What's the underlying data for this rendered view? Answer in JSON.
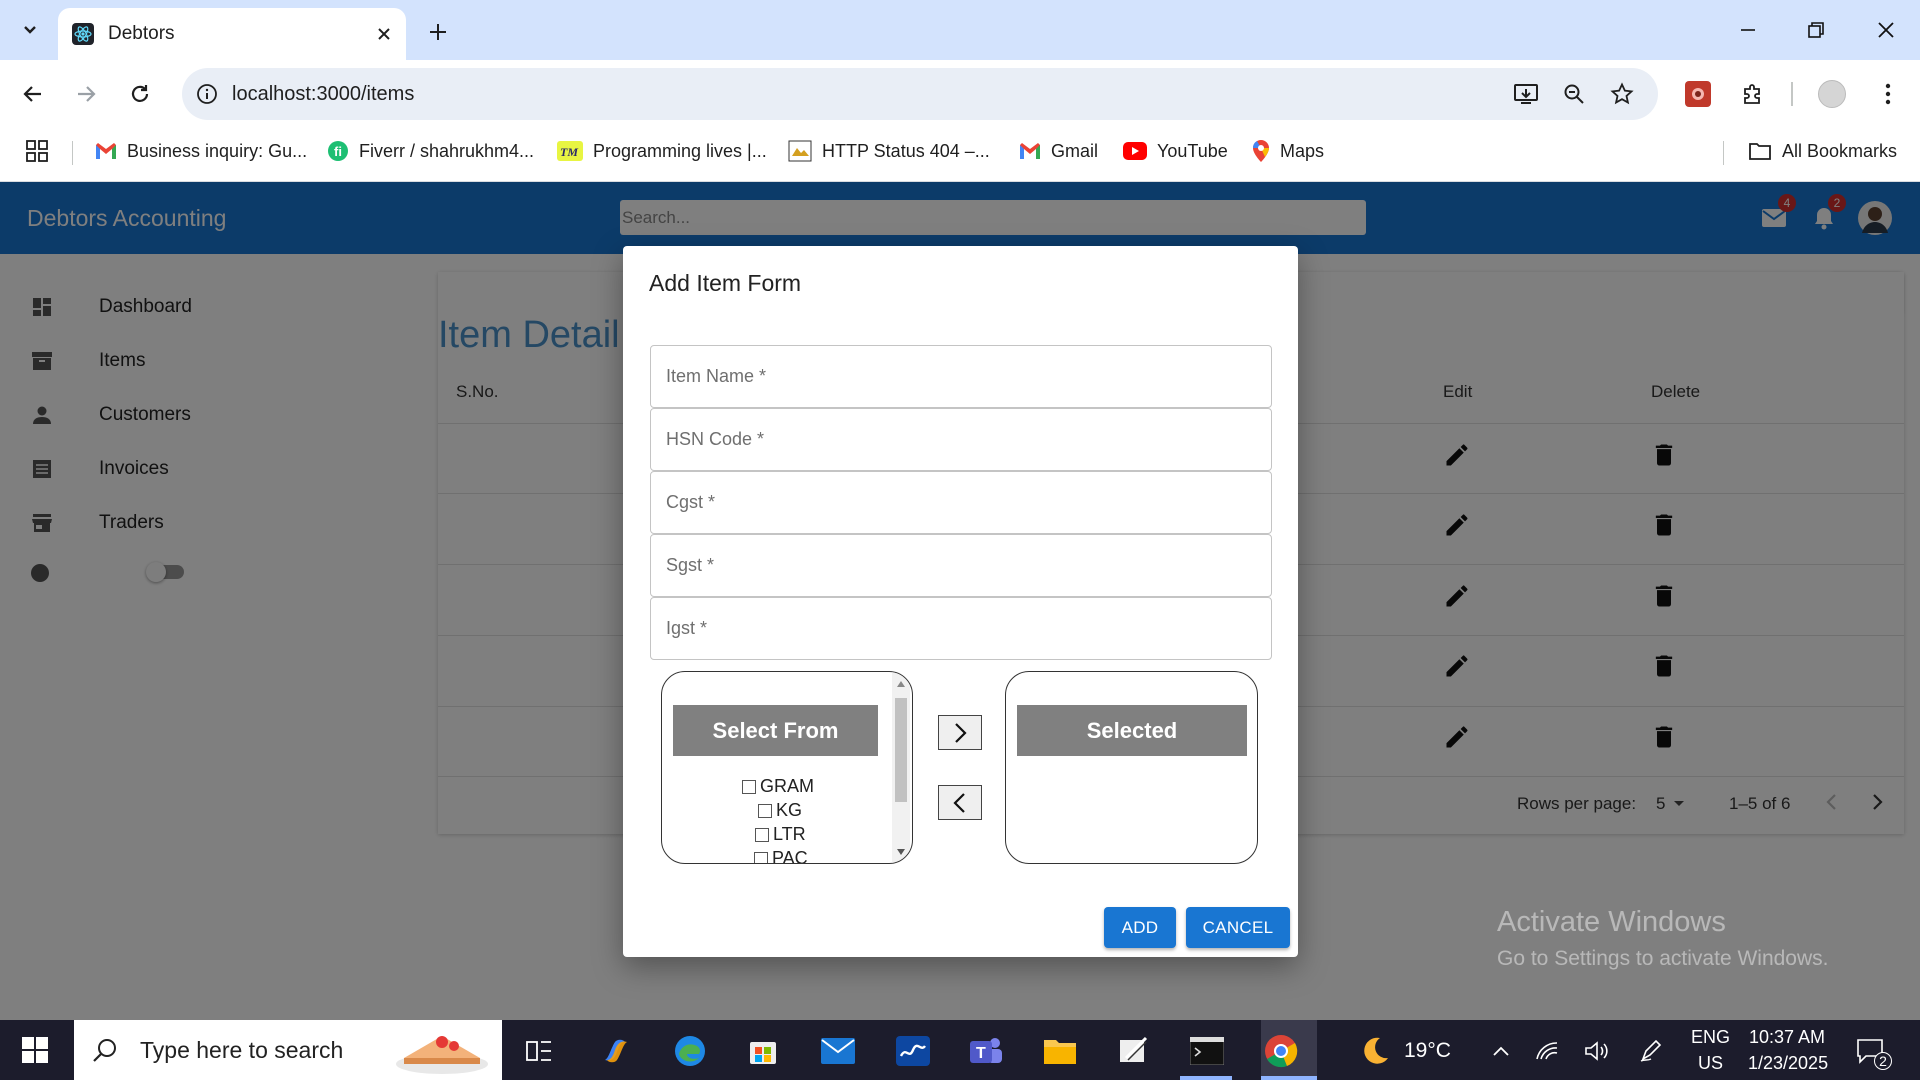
{
  "browser": {
    "tab_title": "Debtors",
    "url": "localhost:3000/items",
    "bookmarks": [
      {
        "label": "Business inquiry: Gu...",
        "icon": "gmail-icon"
      },
      {
        "label": "Fiverr / shahrukhm4...",
        "icon": "fiverr-icon"
      },
      {
        "label": "Programming lives |...",
        "icon": "tm-icon"
      },
      {
        "label": "HTTP Status 404 –...",
        "icon": "tomcat-icon"
      },
      {
        "label": "Gmail",
        "icon": "gmail-icon"
      },
      {
        "label": "YouTube",
        "icon": "youtube-icon"
      },
      {
        "label": "Maps",
        "icon": "maps-icon"
      }
    ],
    "all_bookmarks": "All Bookmarks"
  },
  "app": {
    "title": "Debtors Accounting",
    "search_placeholder": "Search...",
    "mail_count": "4",
    "notification_count": "2",
    "colors": {
      "primary": "#1976d2",
      "heading": "#4a90c8"
    }
  },
  "sidebar": {
    "items": [
      {
        "label": "Dashboard",
        "icon": "dashboard-icon"
      },
      {
        "label": "Items",
        "icon": "archive-icon"
      },
      {
        "label": "Customers",
        "icon": "person-icon"
      },
      {
        "label": "Invoices",
        "icon": "list-icon"
      },
      {
        "label": "Traders",
        "icon": "store-icon"
      }
    ]
  },
  "page": {
    "heading": "Item Detail",
    "columns": {
      "sno": "S.No.",
      "edit": "Edit",
      "delete": "Delete"
    },
    "pagination": {
      "rows_per_page_label": "Rows per page:",
      "rows_per_page": "5",
      "range": "1–5 of 6"
    }
  },
  "dialog": {
    "title": "Add Item Form",
    "fields": {
      "item_name": "Item Name *",
      "hsn_code": "HSN Code *",
      "cgst": "Cgst *",
      "sgst": "Sgst *",
      "igst": "Igst *"
    },
    "select_from_label": "Select From",
    "selected_label": "Selected",
    "units": [
      "GRAM",
      "KG",
      "LTR",
      "PAC"
    ],
    "add_button": "ADD",
    "cancel_button": "CANCEL"
  },
  "windows": {
    "watermark_title": "Activate Windows",
    "watermark_sub": "Go to Settings to activate Windows.",
    "search_placeholder": "Type here to search",
    "weather": "19°C",
    "language": "ENG",
    "region": "US",
    "time": "10:37 AM",
    "date": "1/23/2025",
    "notification_count": "2"
  }
}
